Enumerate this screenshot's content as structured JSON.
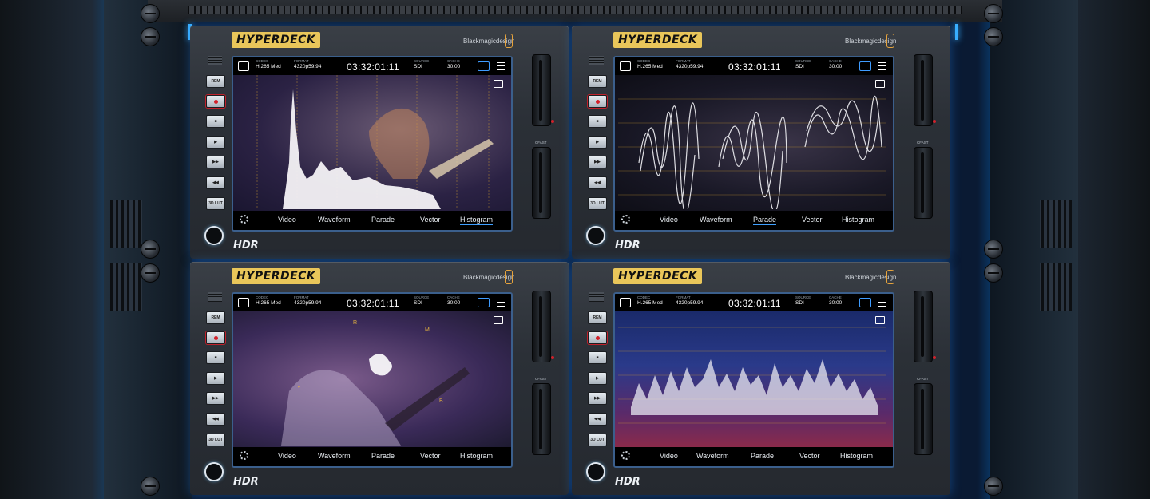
{
  "units": [
    {
      "logo": "HYPERDECK",
      "brand": "Blackmagicdesign",
      "badge": "HDR",
      "status": {
        "codec_label": "CODEC",
        "codec": "H.265 Med",
        "format_label": "FORMAT",
        "format": "4320p59.94",
        "timecode": "03:32:01:11",
        "source_label": "SOURCE",
        "source": "SDI",
        "cache_label": "CACHE",
        "cache": "30:00"
      },
      "tabs": [
        "Video",
        "Waveform",
        "Parade",
        "Vector",
        "Histogram"
      ],
      "active_tab": "Histogram",
      "buttons": [
        "REM",
        "REC",
        "STOP",
        "PLAY",
        "FWD",
        "REV",
        "3D LUT"
      ]
    },
    {
      "logo": "HYPERDECK",
      "brand": "Blackmagicdesign",
      "badge": "HDR",
      "status": {
        "codec_label": "CODEC",
        "codec": "H.265 Med",
        "format_label": "FORMAT",
        "format": "4320p59.94",
        "timecode": "03:32:01:11",
        "source_label": "SOURCE",
        "source": "SDI",
        "cache_label": "CACHE",
        "cache": "30:00"
      },
      "tabs": [
        "Video",
        "Waveform",
        "Parade",
        "Vector",
        "Histogram"
      ],
      "active_tab": "Parade",
      "buttons": [
        "REM",
        "REC",
        "STOP",
        "PLAY",
        "FWD",
        "REV",
        "3D LUT"
      ]
    },
    {
      "logo": "HYPERDECK",
      "brand": "Blackmagicdesign",
      "badge": "HDR",
      "status": {
        "codec_label": "CODEC",
        "codec": "H.265 Med",
        "format_label": "FORMAT",
        "format": "4320p59.94",
        "timecode": "03:32:01:11",
        "source_label": "SOURCE",
        "source": "SDI",
        "cache_label": "CACHE",
        "cache": "30:00"
      },
      "tabs": [
        "Video",
        "Waveform",
        "Parade",
        "Vector",
        "Histogram"
      ],
      "active_tab": "Vector",
      "buttons": [
        "REM",
        "REC",
        "STOP",
        "PLAY",
        "FWD",
        "REV",
        "3D LUT"
      ]
    },
    {
      "logo": "HYPERDECK",
      "brand": "Blackmagicdesign",
      "badge": "HDR",
      "status": {
        "codec_label": "CODEC",
        "codec": "H.265 Med",
        "format_label": "FORMAT",
        "format": "4320p59.94",
        "timecode": "03:32:01:11",
        "source_label": "SOURCE",
        "source": "SDI",
        "cache_label": "CACHE",
        "cache": "30:00"
      },
      "tabs": [
        "Video",
        "Waveform",
        "Parade",
        "Vector",
        "Histogram"
      ],
      "active_tab": "Waveform",
      "buttons": [
        "REM",
        "REC",
        "STOP",
        "PLAY",
        "FWD",
        "REV",
        "3D LUT"
      ]
    }
  ],
  "slot_label": "CFAST",
  "vectorscope_targets": [
    "R",
    "M",
    "Y",
    "B"
  ],
  "colors": {
    "accent": "#3fa0ff",
    "logo_bg": "#e9c65a",
    "rec_red": "#d3202a",
    "ambient_blue": "#0b5ea8"
  }
}
